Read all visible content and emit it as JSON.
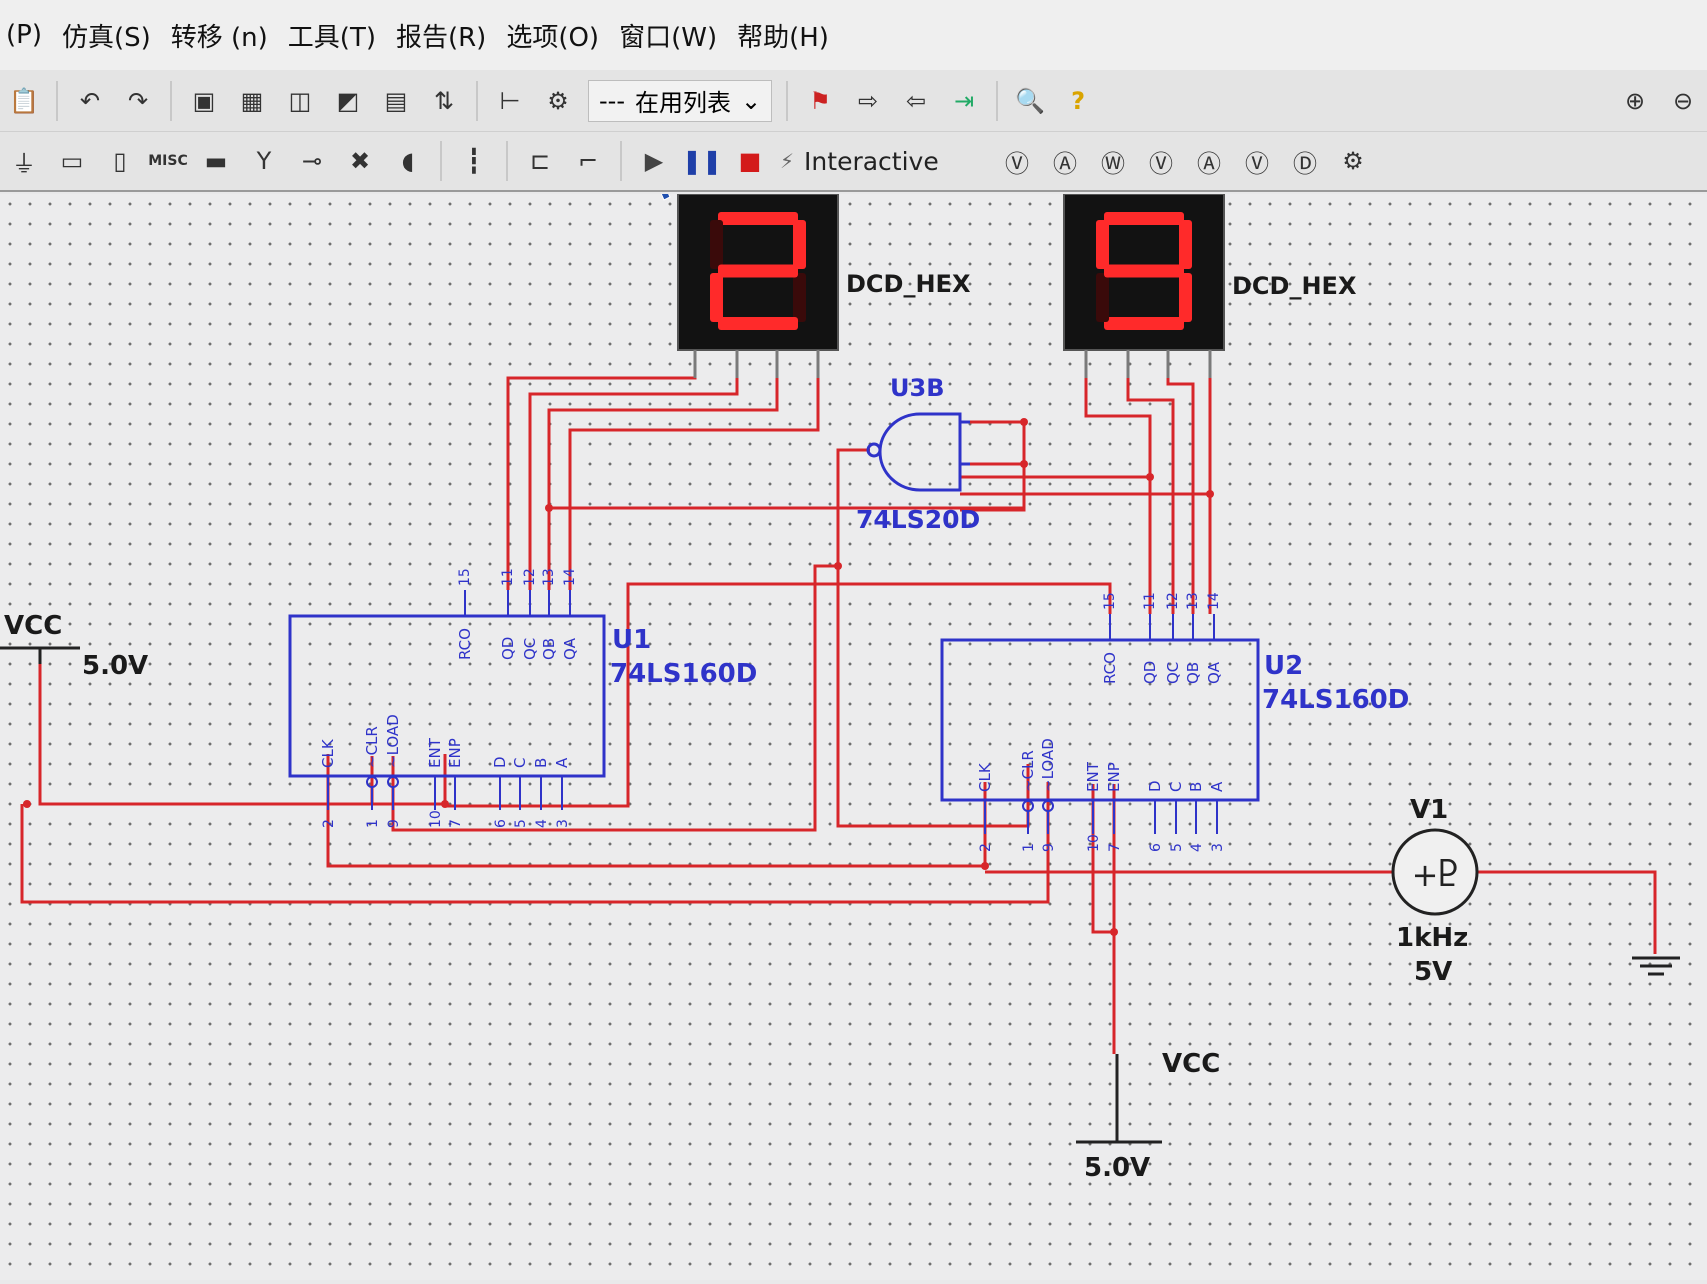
{
  "menu": [
    "(P)",
    "仿真(S)",
    "转移 (n)",
    "工具(T)",
    "报告(R)",
    "选项(O)",
    "窗口(W)",
    "帮助(H)"
  ],
  "toolbar": {
    "in_use_list_label": "在用列表",
    "sim_mode": "Interactive",
    "misc_label": "MISC"
  },
  "schematic": {
    "display1": {
      "digit": "2",
      "label": "DCD_HEX"
    },
    "display2": {
      "digit": "9",
      "label": "DCD_HEX"
    },
    "gate": {
      "ref": "U3B",
      "part": "74LS20D"
    },
    "counter1": {
      "ref": "U1",
      "part": "74LS160D",
      "top_pins": [
        "15",
        "11",
        "12",
        "13",
        "14"
      ],
      "top_labels": [
        "RCO",
        "QD",
        "QC",
        "QB",
        "QA"
      ],
      "bottom_labels": [
        "CLK",
        "~CLR",
        "~LOAD",
        "ENT",
        "ENP",
        "D",
        "C",
        "B",
        "A"
      ],
      "bottom_pins": [
        "2",
        "1",
        "9",
        "10",
        "7",
        "6",
        "5",
        "4",
        "3"
      ]
    },
    "counter2": {
      "ref": "U2",
      "part": "74LS160D",
      "top_pins": [
        "15",
        "11",
        "12",
        "13",
        "14"
      ],
      "top_labels": [
        "RCO",
        "QD",
        "QC",
        "QB",
        "QA"
      ],
      "bottom_labels": [
        "CLK",
        "~CLR",
        "~LOAD",
        "ENT",
        "ENP",
        "D",
        "C",
        "B",
        "A"
      ],
      "bottom_pins": [
        "2",
        "1",
        "9",
        "10",
        "7",
        "6",
        "5",
        "4",
        "3"
      ]
    },
    "vcc1": {
      "label": "VCC",
      "voltage": "5.0V"
    },
    "vcc2": {
      "label": "VCC",
      "voltage": "5.0V"
    },
    "source": {
      "ref": "V1",
      "freq": "1kHz",
      "amplitude": "5V"
    },
    "colors": {
      "wire": "#d7262a",
      "component": "#2f33c9",
      "segment_on": "#ff2a2a",
      "segment_off": "#3a0a0a",
      "display_bg": "#121212"
    }
  }
}
